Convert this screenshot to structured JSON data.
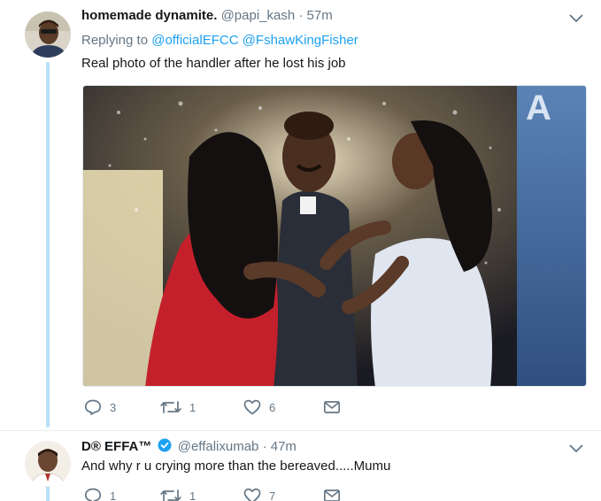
{
  "tweets": [
    {
      "display_name": "homemade dynamite.",
      "handle": "@papi_kash",
      "separator": "·",
      "time": "57m",
      "replying_label": "Replying to",
      "mentions": [
        "@officialEFCC",
        "@FshawKingFisher"
      ],
      "text": "Real photo of the handler after he lost his job",
      "counts": {
        "replies": "3",
        "retweets": "1",
        "likes": "6"
      }
    },
    {
      "display_name": "D® EFFA™",
      "verified": true,
      "handle": "@effalixumab",
      "separator": "·",
      "time": "47m",
      "text": "And why r u crying more than the bereaved.....Mumu",
      "counts": {
        "replies": "1",
        "retweets": "1",
        "likes": "7"
      }
    }
  ],
  "colors": {
    "link": "#1da1f2",
    "secondary_text": "#657786",
    "thread_line": "#b6e0f7",
    "primary_text": "#14171a"
  },
  "icons": [
    "chevron-down-icon",
    "reply-icon",
    "retweet-icon",
    "heart-icon",
    "direct-message-icon",
    "verified-badge-icon"
  ]
}
